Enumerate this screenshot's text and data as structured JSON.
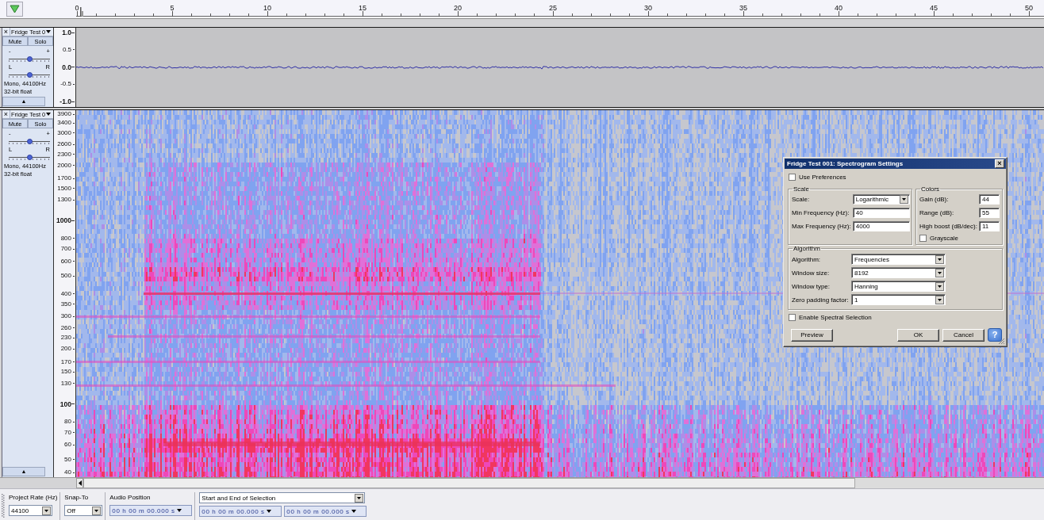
{
  "timeline": {
    "labels": [
      "0",
      "5",
      "10",
      "15",
      "20",
      "25",
      "30",
      "35",
      "40",
      "45",
      "50"
    ]
  },
  "tracks": [
    {
      "kind": "waveform",
      "close": "×",
      "name": "Fridge Test 0",
      "mute": "Mute",
      "solo": "Solo",
      "gain": {
        "minus": "-",
        "plus": "+",
        "level": 0.5
      },
      "pan": {
        "left": "L",
        "right": "R",
        "level": 0.5
      },
      "info": [
        "Mono, 44100Hz",
        "32-bit float"
      ],
      "collapse": "▲",
      "axis": [
        {
          "text": "1.0",
          "major": true
        },
        {
          "text": "0.5",
          "major": false
        },
        {
          "text": "0.0",
          "major": true
        },
        {
          "text": "-0.5",
          "major": false
        },
        {
          "text": "-1.0",
          "major": true
        }
      ]
    },
    {
      "kind": "spectrogram",
      "close": "×",
      "name": "Fridge Test 0",
      "mute": "Mute",
      "solo": "Solo",
      "gain": {
        "minus": "-",
        "plus": "+",
        "level": 0.5
      },
      "pan": {
        "left": "L",
        "right": "R",
        "level": 0.5
      },
      "info": [
        "Mono, 44100Hz",
        "32-bit float"
      ],
      "collapse": "▲",
      "axis": [
        {
          "text": "3900",
          "major": false
        },
        {
          "text": "3400",
          "major": false
        },
        {
          "text": "3000",
          "major": false
        },
        {
          "text": "2600",
          "major": false
        },
        {
          "text": "2300",
          "major": false
        },
        {
          "text": "2000",
          "major": false
        },
        {
          "text": "1700",
          "major": false
        },
        {
          "text": "1500",
          "major": false
        },
        {
          "text": "1300",
          "major": false
        },
        {
          "text": "1000",
          "major": true
        },
        {
          "text": "800",
          "major": false
        },
        {
          "text": "700",
          "major": false
        },
        {
          "text": "600",
          "major": false
        },
        {
          "text": "500",
          "major": false
        },
        {
          "text": "400",
          "major": false
        },
        {
          "text": "350",
          "major": false
        },
        {
          "text": "300",
          "major": false
        },
        {
          "text": "260",
          "major": false
        },
        {
          "text": "230",
          "major": false
        },
        {
          "text": "200",
          "major": false
        },
        {
          "text": "170",
          "major": false
        },
        {
          "text": "150",
          "major": false
        },
        {
          "text": "130",
          "major": false
        },
        {
          "text": "100",
          "major": true
        },
        {
          "text": "80",
          "major": false
        },
        {
          "text": "70",
          "major": false
        },
        {
          "text": "60",
          "major": false
        },
        {
          "text": "50",
          "major": false
        },
        {
          "text": "40",
          "major": false
        }
      ]
    }
  ],
  "dialog": {
    "title": "Fridge Test 001: Spectrogram Settings",
    "close": "×",
    "use_preferences": {
      "label": "Use Preferences",
      "checked": false
    },
    "scale": {
      "title": "Scale",
      "fields": [
        {
          "kind": "dropdown",
          "label": "Scale:",
          "value": "Logarithmic"
        },
        {
          "kind": "text",
          "label": "Min Frequency (Hz):",
          "value": "40"
        },
        {
          "kind": "text",
          "label": "Max Frequency (Hz):",
          "value": "4000"
        }
      ]
    },
    "colors": {
      "title": "Colors",
      "fields": [
        {
          "kind": "text",
          "label": "Gain (dB):",
          "value": "44"
        },
        {
          "kind": "text",
          "label": "Range (dB):",
          "value": "55"
        },
        {
          "kind": "text",
          "label": "High boost (dB/dec):",
          "value": "11"
        }
      ],
      "grayscale": {
        "label": "Grayscale",
        "checked": false
      }
    },
    "algorithm": {
      "title": "Algorithm",
      "fields": [
        {
          "kind": "dropdown",
          "label": "Algorithm:",
          "value": "Frequencies"
        },
        {
          "kind": "dropdown",
          "label": "Window size:",
          "value": "8192"
        },
        {
          "kind": "dropdown",
          "label": "Window type:",
          "value": "Hanning"
        },
        {
          "kind": "dropdown",
          "label": "Zero padding factor:",
          "value": "1"
        }
      ]
    },
    "spectral_selection": {
      "label": "Enable Spectral Selection",
      "checked": false
    },
    "buttons": [
      {
        "kind": "push",
        "label": "Preview"
      },
      {
        "kind": "push",
        "label": "OK"
      },
      {
        "kind": "push",
        "label": "Cancel"
      },
      {
        "kind": "help",
        "label": "?"
      }
    ]
  },
  "toolbar": {
    "project_rate": {
      "label": "Project Rate (Hz)",
      "value": "44100"
    },
    "snap_to": {
      "label": "Snap-To",
      "value": "Off"
    },
    "audio_position": {
      "label": "Audio Position",
      "value": "00 h 00 m 00.000 s"
    },
    "selection": {
      "mode": "Start and End of Selection",
      "start": "00 h 00 m 00.000 s",
      "end": "00 h 00 m 00.000 s"
    }
  }
}
